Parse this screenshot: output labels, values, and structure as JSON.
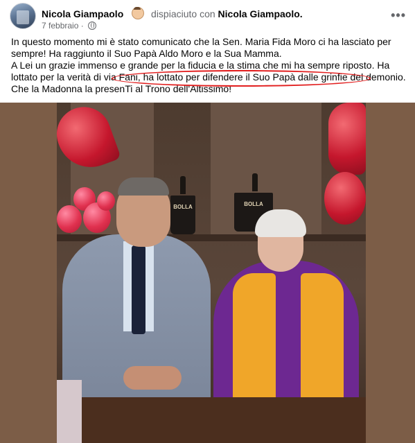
{
  "post": {
    "author": "Nicola Giampaolo",
    "feeling": "dispiaciuto con",
    "tagged": "Nicola Giampaolo.",
    "date": "7 febbraio",
    "date_separator": "·",
    "audience_icon": "globe-icon",
    "more_options": "•••",
    "paragraph_1": "In questo momento mi è stato comunicato che la Sen. Maria Fida Moro ci ha lasciato per sempre! Ha raggiunto il Suo Papà Aldo Moro e la Sua Mamma.",
    "paragraph_2": "A Lei un grazie immenso e grande per la fiducia e la stima che mi ha sempre riposto. Ha lottato per la verità di via Fani, ha lottato per difendere il Suo Papà dalle grinfie del demonio. Che la Madonna la presenTi al Trono dell'Altissimo!",
    "highlight_color": "#e21f1f"
  },
  "photo": {
    "bucket_label": "BOLLA"
  },
  "colors": {
    "name_text": "#050505",
    "secondary_text": "#65676b"
  }
}
